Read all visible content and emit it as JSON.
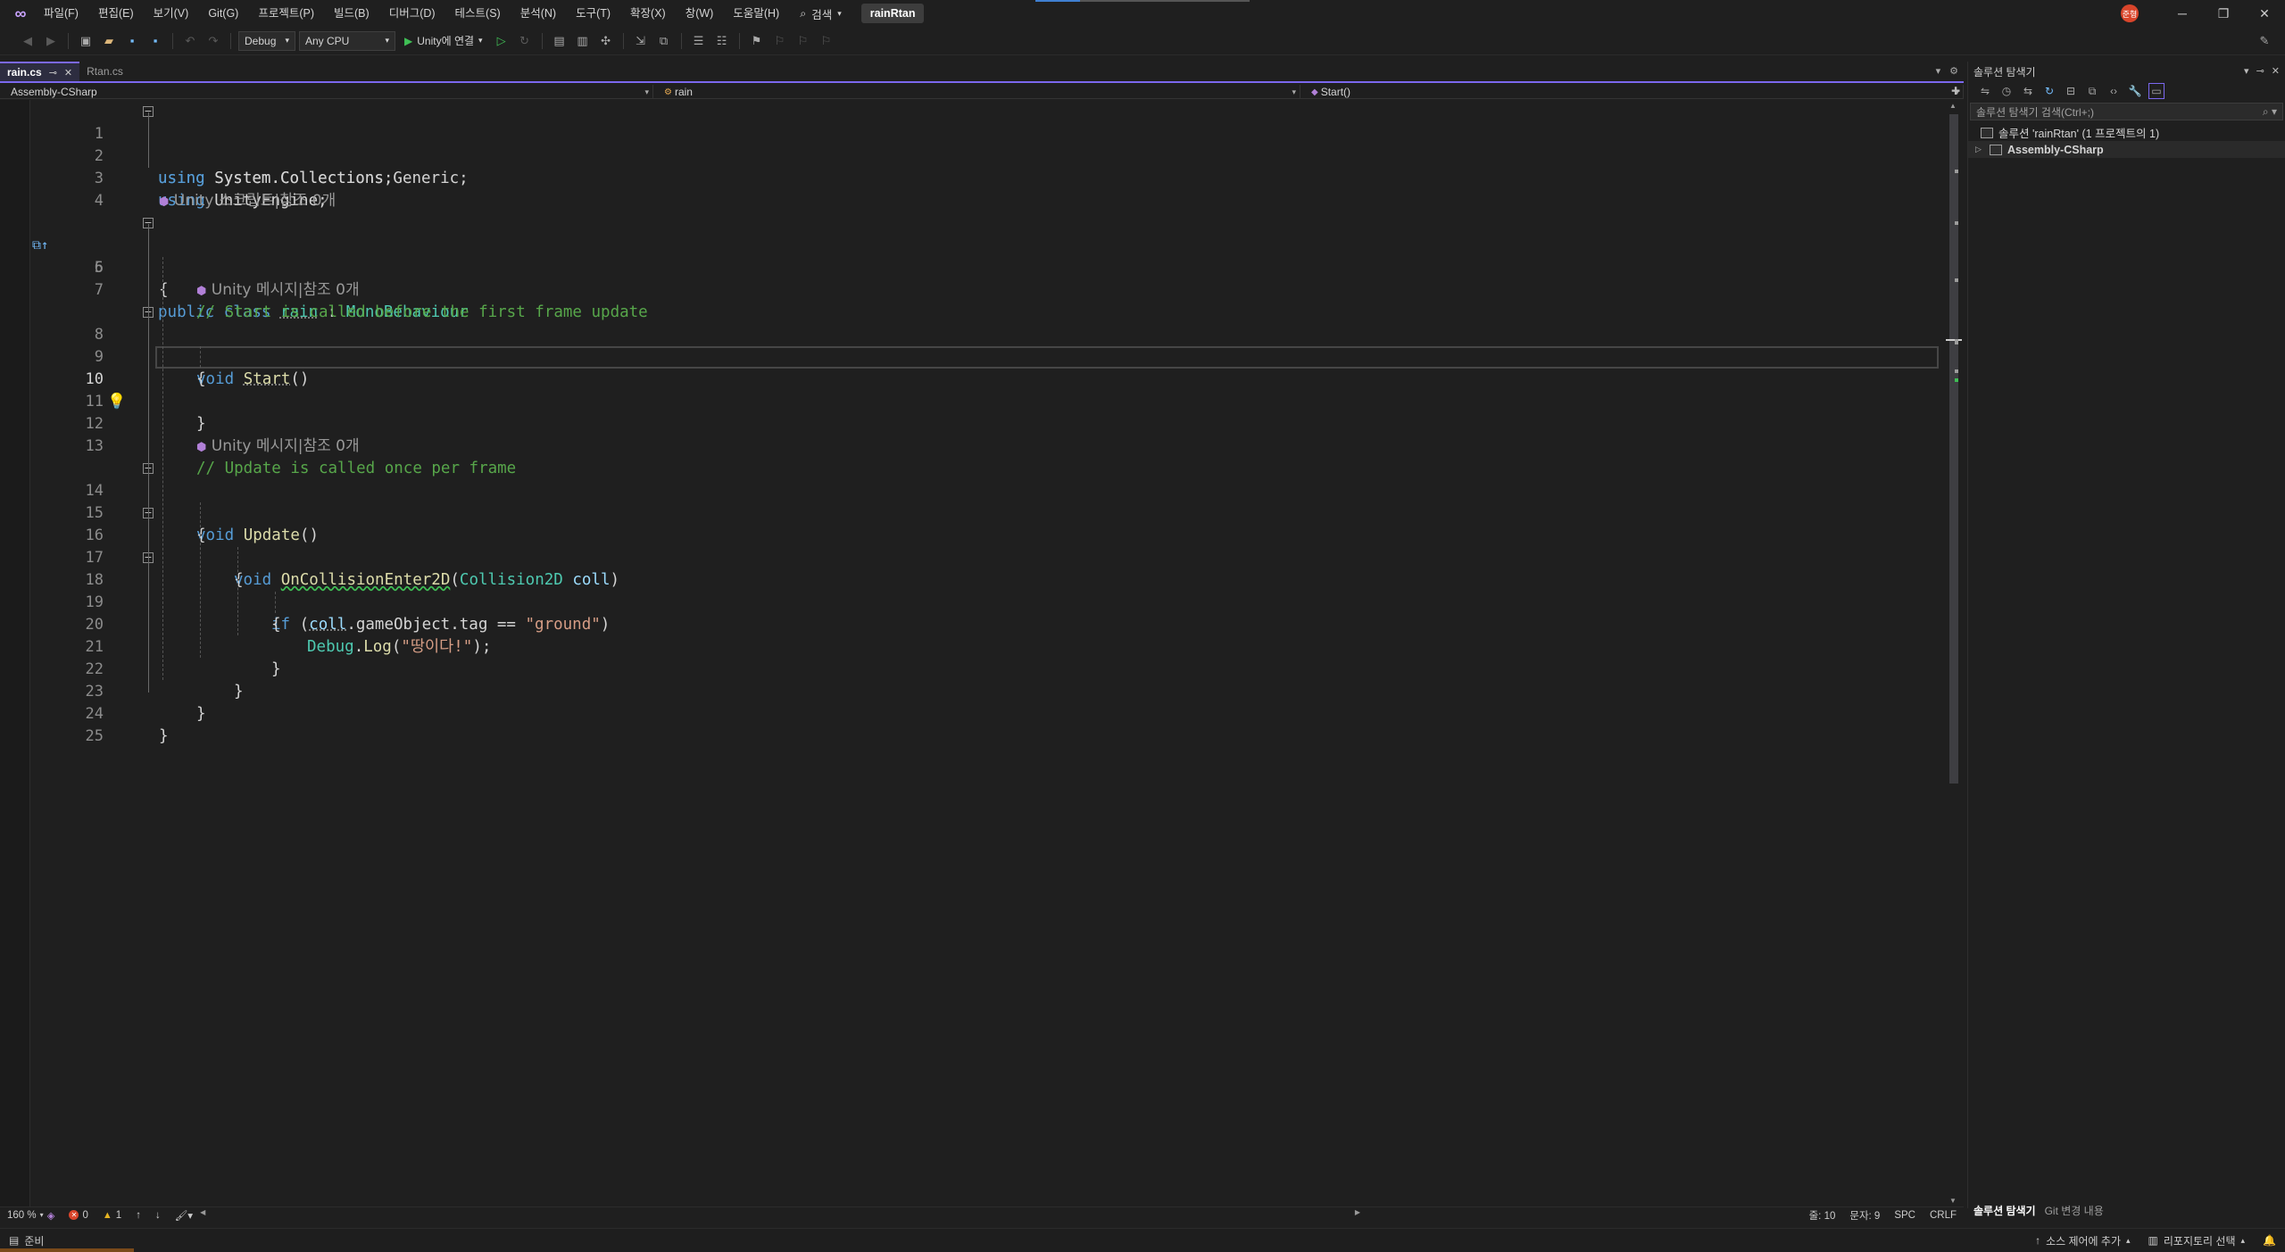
{
  "menubar": {
    "items": [
      "파일(F)",
      "편집(E)",
      "보기(V)",
      "Git(G)",
      "프로젝트(P)",
      "빌드(B)",
      "디버그(D)",
      "테스트(S)",
      "분석(N)",
      "도구(T)",
      "확장(X)",
      "창(W)",
      "도움말(H)"
    ],
    "search": "검색",
    "solution_name": "rainRtan",
    "user_initials": "준형"
  },
  "toolbar": {
    "configuration": "Debug",
    "platform": "Any CPU",
    "run_label": "Unity에 연결"
  },
  "tabs": [
    {
      "label": "rain.cs",
      "active": true
    },
    {
      "label": "Rtan.cs",
      "active": false
    }
  ],
  "navbar": {
    "project": "Assembly-CSharp",
    "class": "rain",
    "member": "Start()"
  },
  "editor": {
    "current_line": 10,
    "codelens": {
      "script": "Unity 스크립트|참조 0개",
      "message1": "Unity 메시지|참조 0개",
      "message2": "Unity 메시지|참조 0개"
    },
    "lines": {
      "l1": {
        "kw": "using",
        "rest": " System.Collections;"
      },
      "l2": {
        "kw": "using",
        "rest": " System.Collections.Generic;"
      },
      "l3": {
        "kw": "using",
        "rest": " UnityEngine;"
      },
      "l5": {
        "kw": "public class",
        "name": "rain",
        "sep": " : ",
        "base": "MonoBehaviour"
      },
      "l6": "{",
      "l7": "// Start is called before the first frame update",
      "l8": {
        "kw": "void",
        "name": "Start",
        "rest": "()"
      },
      "l9": "{",
      "l11": "}",
      "l13": "// Update is called once per frame",
      "l14": {
        "kw": "void",
        "name": "Update",
        "rest": "()"
      },
      "l15": "{",
      "l16": {
        "kw": "void",
        "name": "OnCollisionEnter2D",
        "open": "(",
        "type": "Collision2D",
        "param": "coll",
        "close": ")"
      },
      "l17": "{",
      "l18": {
        "kw": "if",
        "open": " (",
        "var": "coll",
        "rest": ".gameObject.tag == ",
        "str": "\"ground\"",
        "close": ")"
      },
      "l19": "{",
      "l20": {
        "type": "Debug",
        "dot": ".",
        "fn": "Log",
        "open": "(",
        "str": "\"땅이다!\"",
        "close": ");"
      },
      "l21": "}",
      "l22": "}",
      "l23": "}",
      "l24": "}"
    }
  },
  "solution_explorer": {
    "title": "솔루션 탐색기",
    "search_placeholder": "솔루션 탐색기 검색(Ctrl+;)",
    "solution_node": "솔루션 'rainRtan' (1 프로젝트의 1)",
    "project_node": "Assembly-CSharp",
    "bottom_tabs": [
      "솔루션 탐색기",
      "Git 변경 내용"
    ]
  },
  "editor_status": {
    "zoom": "160 %",
    "errors": "0",
    "warnings": "1",
    "line": "줄: 10",
    "char": "문자: 9",
    "whitespace": "SPC",
    "eol": "CRLF"
  },
  "statusbar": {
    "ready": "준비",
    "source_control": "소스 제어에 추가",
    "repo": "리포지토리 선택"
  },
  "colors": {
    "keyword": "#569cd6",
    "type": "#4ec9b0",
    "comment": "#57a64a",
    "string": "#d69d85",
    "accent": "#7b68ee"
  }
}
